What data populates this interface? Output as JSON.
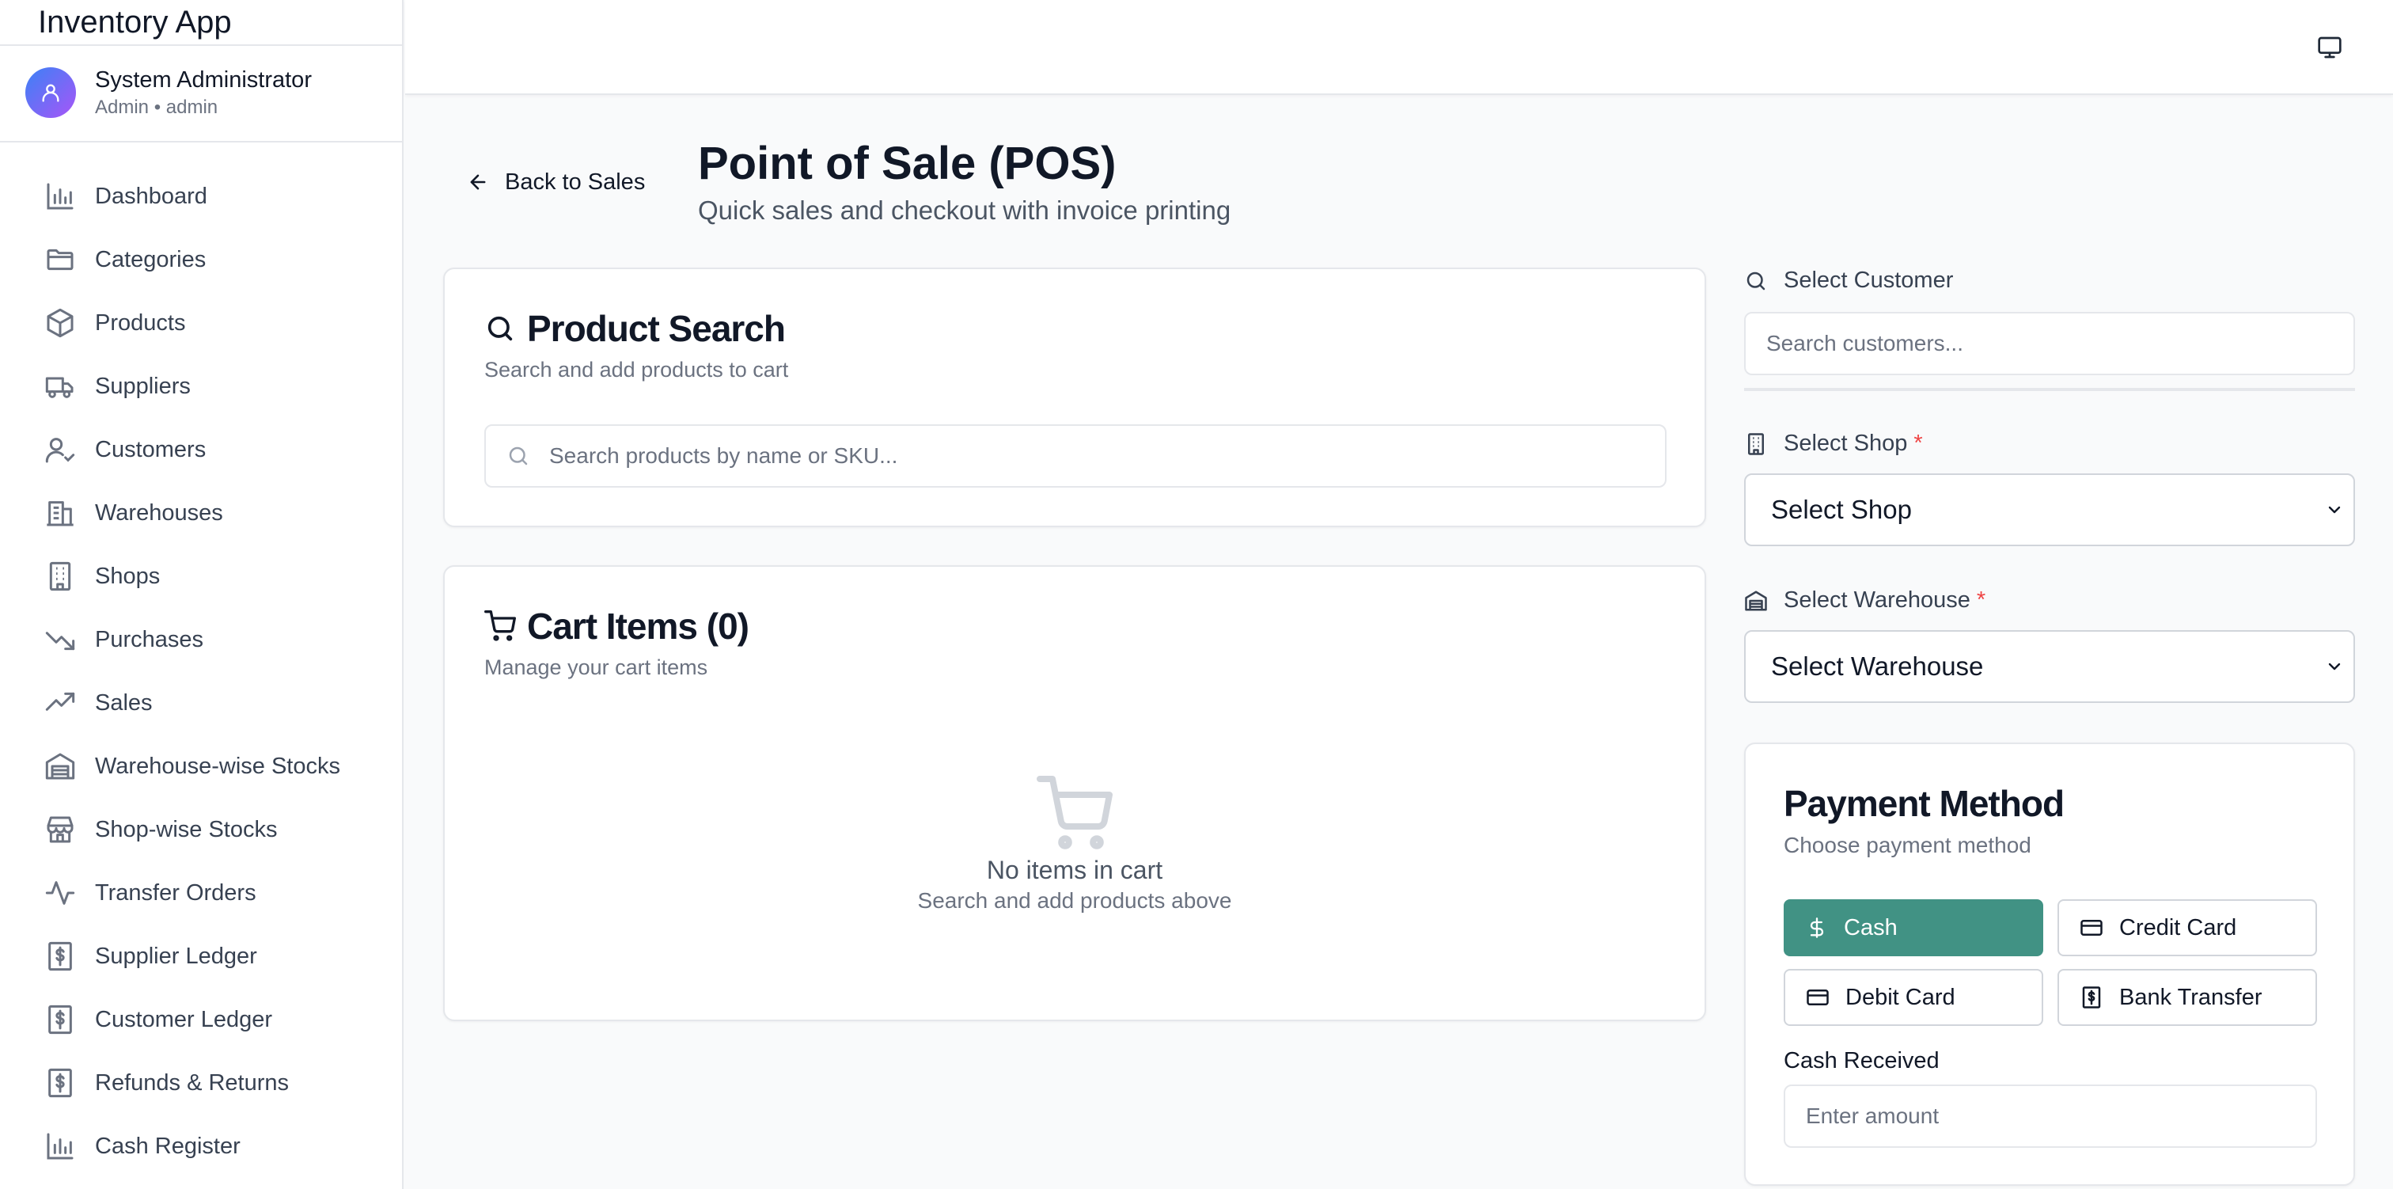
{
  "app": {
    "title": "Inventory App"
  },
  "user": {
    "name": "System Administrator",
    "role": "Admin • admin"
  },
  "sidebar": {
    "items": [
      {
        "label": "Dashboard",
        "icon": "bar-chart-icon"
      },
      {
        "label": "Categories",
        "icon": "folder-icon"
      },
      {
        "label": "Products",
        "icon": "package-icon"
      },
      {
        "label": "Suppliers",
        "icon": "truck-icon"
      },
      {
        "label": "Customers",
        "icon": "user-check-icon"
      },
      {
        "label": "Warehouses",
        "icon": "buildings-icon"
      },
      {
        "label": "Shops",
        "icon": "building-icon"
      },
      {
        "label": "Purchases",
        "icon": "trending-down-icon"
      },
      {
        "label": "Sales",
        "icon": "trending-up-icon"
      },
      {
        "label": "Warehouse-wise Stocks",
        "icon": "warehouse-icon"
      },
      {
        "label": "Shop-wise Stocks",
        "icon": "store-icon"
      },
      {
        "label": "Transfer Orders",
        "icon": "activity-icon"
      },
      {
        "label": "Supplier Ledger",
        "icon": "receipt-icon"
      },
      {
        "label": "Customer Ledger",
        "icon": "receipt-icon"
      },
      {
        "label": "Refunds & Returns",
        "icon": "receipt-icon"
      },
      {
        "label": "Cash Register",
        "icon": "bar-chart-icon"
      }
    ]
  },
  "header": {
    "back_label": "Back to Sales",
    "title": "Point of Sale (POS)",
    "subtitle": "Quick sales and checkout with invoice printing"
  },
  "product_search": {
    "title": "Product Search",
    "subtitle": "Search and add products to cart",
    "placeholder": "Search products by name or SKU...",
    "value": ""
  },
  "cart": {
    "title": "Cart Items (0)",
    "subtitle": "Manage your cart items",
    "empty_title": "No items in cart",
    "empty_sub": "Search and add products above"
  },
  "customer": {
    "label": "Select Customer",
    "placeholder": "Search customers...",
    "value": ""
  },
  "shop": {
    "label": "Select Shop",
    "required": "*",
    "selected": "Select Shop"
  },
  "warehouse": {
    "label": "Select Warehouse",
    "required": "*",
    "selected": "Select Warehouse"
  },
  "payment": {
    "title": "Payment Method",
    "subtitle": "Choose payment method",
    "methods": [
      {
        "label": "Cash",
        "icon": "dollar-icon",
        "active": true
      },
      {
        "label": "Credit Card",
        "icon": "card-icon",
        "active": false
      },
      {
        "label": "Debit Card",
        "icon": "card-icon",
        "active": false
      },
      {
        "label": "Bank Transfer",
        "icon": "receipt-icon",
        "active": false
      }
    ],
    "cash_label": "Cash Received",
    "cash_placeholder": "Enter amount",
    "cash_value": ""
  },
  "colors": {
    "accent": "#419284",
    "required": "#ef4444",
    "avatar_gradient": [
      "#3b82f6",
      "#a855f7"
    ]
  }
}
